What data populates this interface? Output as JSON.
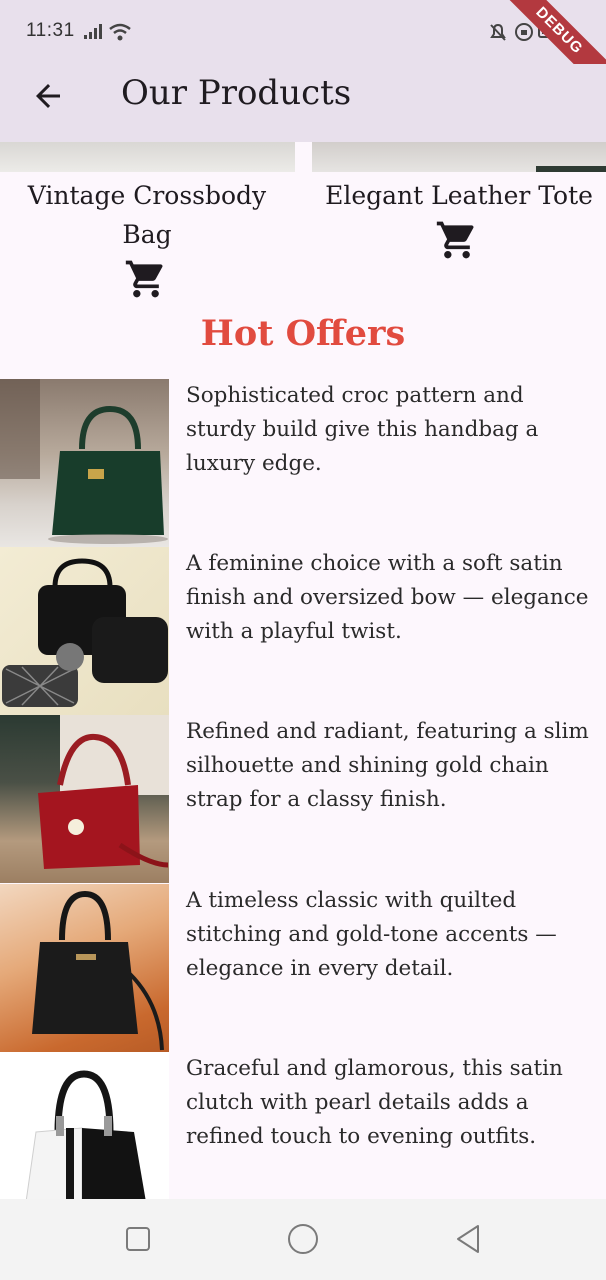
{
  "status": {
    "time": "11:31"
  },
  "debug_ribbon": "DEBUG",
  "appbar": {
    "title": "Our Products"
  },
  "products": [
    {
      "name": "Vintage Crossbody Bag"
    },
    {
      "name": "Elegant Leather Tote"
    }
  ],
  "section_title": "Hot Offers",
  "offers": [
    {
      "description": "Sophisticated croc pattern and sturdy build give this handbag a luxury edge."
    },
    {
      "description": "A feminine choice with a soft satin finish and oversized bow — elegance with a playful twist."
    },
    {
      "description": "Refined and radiant, featuring a slim silhouette and shining gold chain strap for a classy finish."
    },
    {
      "description": "A timeless classic with quilted stitching and gold-tone accents — elegance in every detail."
    },
    {
      "description": "Graceful and glamorous, this satin clutch with pearl details adds a refined touch to evening outfits."
    }
  ],
  "icons": {
    "back": "arrow-left-icon",
    "cart": "shopping-cart-icon",
    "nav_recent": "square-icon",
    "nav_home": "circle-icon",
    "nav_back": "triangle-back-icon"
  },
  "colors": {
    "appbar": "#e8e0ec",
    "hot_offers": "#e14b3f",
    "background": "#fdf7fd"
  }
}
